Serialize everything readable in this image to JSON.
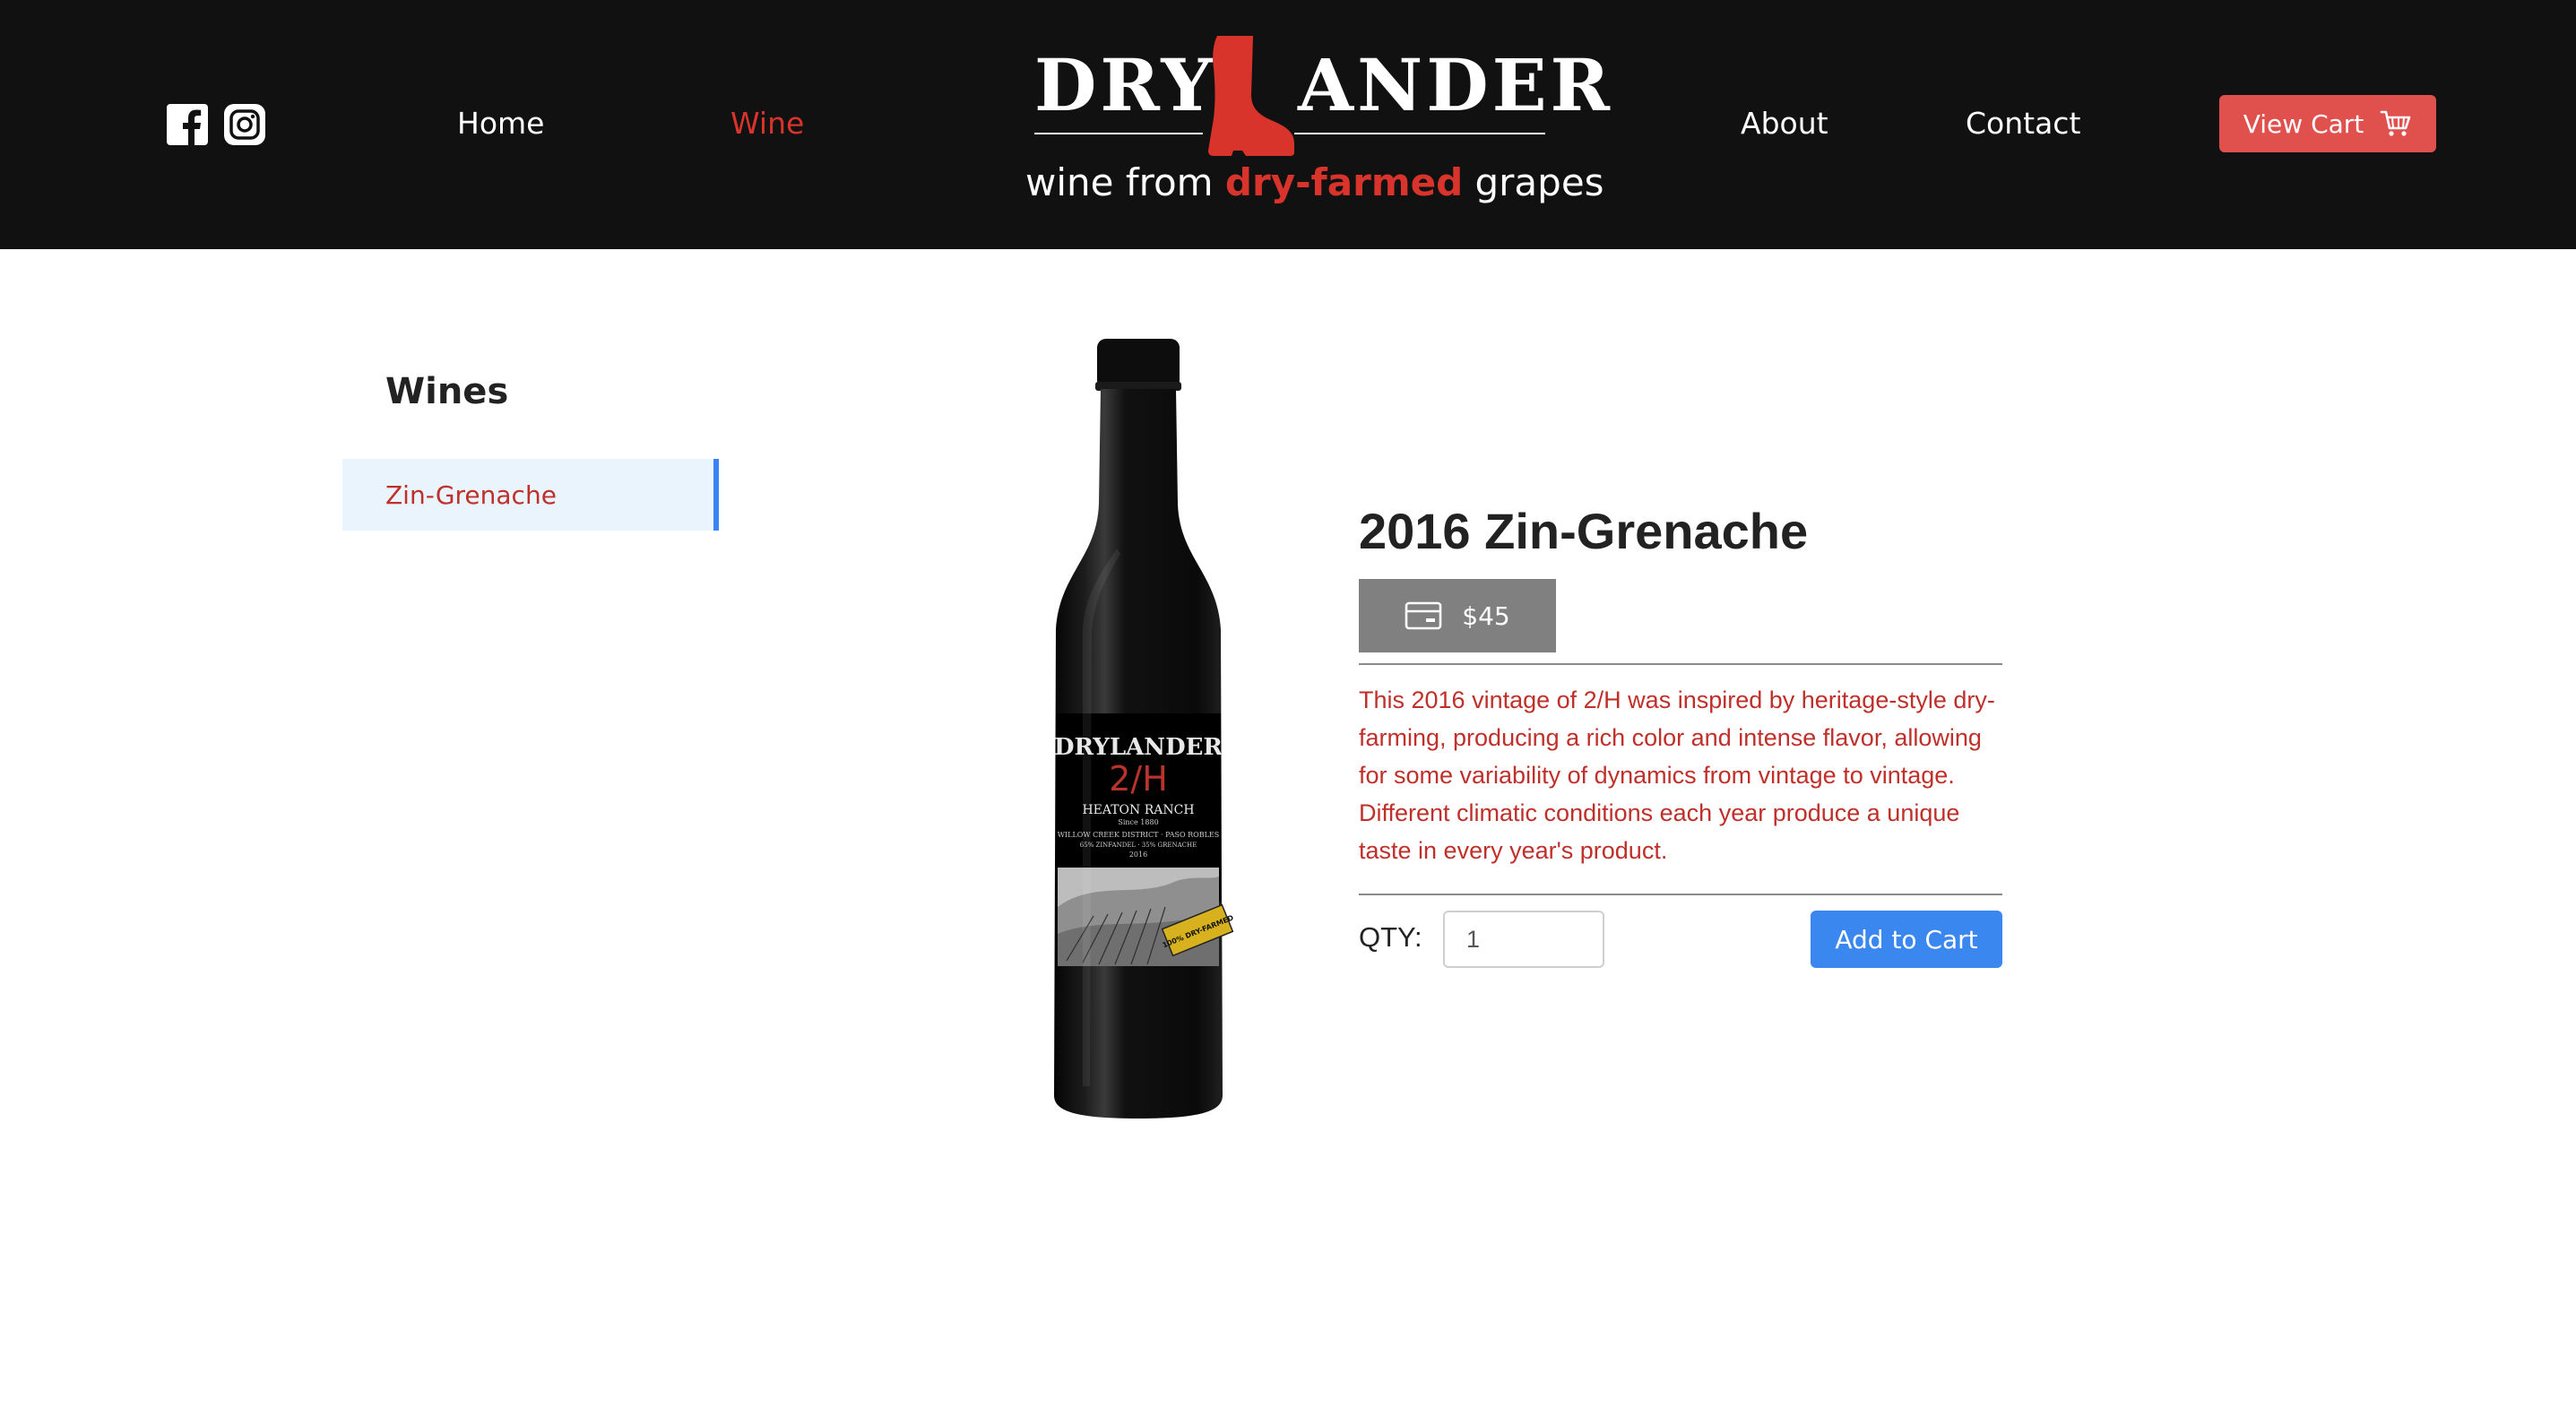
{
  "header": {
    "social": [
      {
        "icon": "facebook-icon"
      },
      {
        "icon": "instagram-icon"
      }
    ],
    "nav": {
      "home": "Home",
      "wine": "Wine",
      "about": "About",
      "contact": "Contact"
    },
    "active_nav": "Wine",
    "logo": {
      "word_left": "DRY",
      "word_right": "ANDER",
      "tagline_pre": "wine from ",
      "tagline_highlight": "dry-farmed",
      "tagline_post": " grapes"
    },
    "cart_button": {
      "label": "View Cart",
      "icon": "cart-icon"
    }
  },
  "sidebar": {
    "title": "Wines",
    "items": [
      {
        "label": "Zin-Grenache",
        "selected": true
      }
    ]
  },
  "product": {
    "year": "2016",
    "name": "Zin-Grenache",
    "price": "$45",
    "price_icon": "credit-card-icon",
    "description": "This 2016 vintage of 2/H was inspired by heritage-style dry-farming, producing a rich color and intense flavor, allowing for some variability of dynamics from vintage to vintage. Different climatic conditions each year produce a unique taste in every year's product.",
    "qty_label": "QTY:",
    "qty_value": "1",
    "add_button": "Add to Cart",
    "bottle_label": {
      "brand": "DRYLANDER",
      "mark": "2/H",
      "ranch": "HEATON RANCH",
      "since": "Since 1880",
      "district": "WILLOW CREEK DISTRICT · PASO ROBLES",
      "blend": "65% ZINFANDEL · 35% GRENACHE",
      "vintage": "2016",
      "badge": "100% DRY-FARMED"
    }
  },
  "colors": {
    "header_bg": "#111111",
    "accent_red": "#d9342b",
    "cart_button": "#e0514d",
    "add_button": "#3b87f0",
    "price_box": "#808080",
    "sidebar_selected_bg": "#e9f4fd",
    "sidebar_selected_border": "#3b82f6"
  }
}
